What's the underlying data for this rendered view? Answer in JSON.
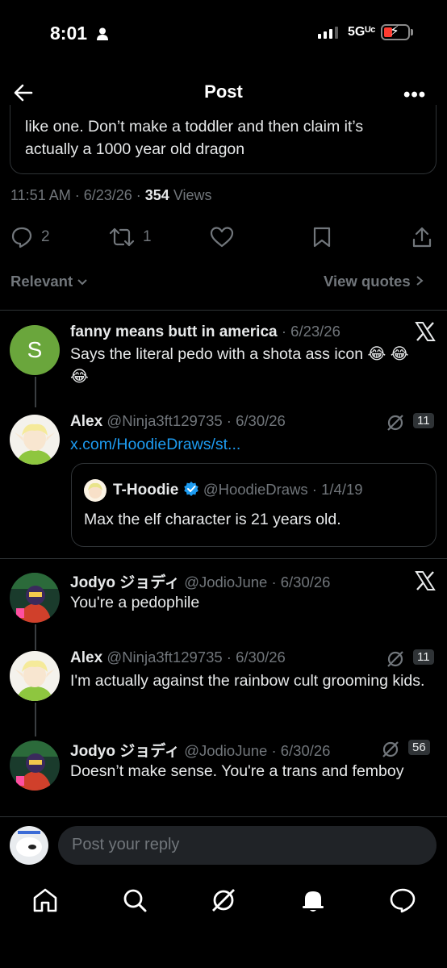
{
  "status_bar": {
    "time": "8:01",
    "network": "5Gᵁᶜ",
    "battery_color": "#ff3b30"
  },
  "header": {
    "title": "Post",
    "more_label": "•••"
  },
  "original_post": {
    "text": "like one. Don’t make a toddler and then claim it’s actually a 1000 year old dragon",
    "meta_prefix": "11:51 AM · 6/23/26 · ",
    "views_count": "354",
    "views_label": " Views",
    "replies": "2",
    "reposts": "1"
  },
  "sort": {
    "left": "Relevant",
    "right": "View quotes"
  },
  "replies": [
    {
      "name": "fanny means butt in america",
      "date": "· 6/23/26",
      "avatar_letter": "S",
      "avatar_color": "#6aa63c",
      "text": "Says the literal pedo with a shota ass icon 😂 😂😂"
    },
    {
      "name": "Alex",
      "handle": "@Ninja3ft129735 · 6/30/26",
      "link": "x.com/HoodieDraws/st...",
      "grok_count": "11",
      "quote": {
        "name": "T-Hoodie",
        "handle": "@HoodieDraws · 1/4/19",
        "text": "Max the elf character is 21 years old."
      }
    },
    {
      "name": "Jodyo ジョディ",
      "handle": "@JodioJune · 6/30/26",
      "text": "You're a pedophile"
    },
    {
      "name": "Alex",
      "handle": "@Ninja3ft129735 · 6/30/26",
      "grok_count": "11",
      "text": "I'm actually against the rainbow cult grooming kids."
    },
    {
      "name": "Jodyo ジョディ",
      "handle": "@JodioJune · 6/30/26",
      "grok_count": "56",
      "text": "Doesn’t make sense. You're a trans and femboy"
    }
  ],
  "composer": {
    "placeholder": "Post your reply"
  },
  "icons": {
    "back": "back-arrow-icon",
    "reply": "reply-icon",
    "repost": "repost-icon",
    "like": "heart-icon",
    "bookmark": "bookmark-icon",
    "share": "share-icon",
    "x_logo": "x-logo-icon",
    "grok": "grok-icon",
    "verified": "verified-badge-icon",
    "tabs": [
      "home-icon",
      "search-icon",
      "grok-icon",
      "notifications-icon",
      "messages-icon"
    ]
  },
  "colors": {
    "accent": "#1d9bf0",
    "muted": "#71767b",
    "text": "#e7e9ea",
    "border": "#2f3336"
  }
}
